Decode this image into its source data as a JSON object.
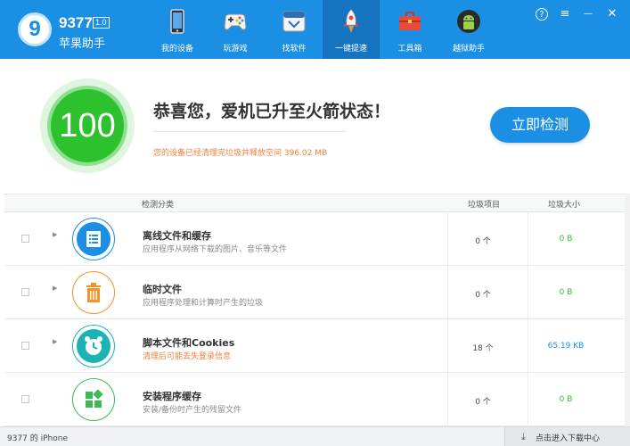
{
  "app": {
    "logo_char": "9",
    "title": "9377",
    "version": "1.0",
    "subtitle": "苹果助手"
  },
  "nav": [
    {
      "label": "我的设备",
      "icon": "phone-icon"
    },
    {
      "label": "玩游戏",
      "icon": "gamepad-icon"
    },
    {
      "label": "找软件",
      "icon": "app-store-icon"
    },
    {
      "label": "一键提速",
      "icon": "rocket-icon",
      "active": true
    },
    {
      "label": "工具箱",
      "icon": "toolbox-icon"
    },
    {
      "label": "越狱助手",
      "icon": "android-icon"
    }
  ],
  "window_controls": {
    "help": "?",
    "menu": "≡",
    "minimize": "—",
    "close": "✕"
  },
  "score": {
    "value": "100",
    "headline": "恭喜您，爱机已升至火箭状态！",
    "subline": "您的设备已经清理完垃圾并释放空间 396.02 MB",
    "check_button": "立即检测"
  },
  "table": {
    "headers": {
      "category": "检测分类",
      "items": "垃圾项目",
      "size": "垃圾大小"
    },
    "rows": [
      {
        "title": "离线文件和缓存",
        "desc": "应用程序从网络下载的图片、音乐等文件",
        "count": "0 个",
        "size": "0 B",
        "icon": "document-list-icon",
        "color": "#1a8fe3"
      },
      {
        "title": "临时文件",
        "desc": "应用程序处理和计算时产生的垃圾",
        "count": "0 个",
        "size": "0 B",
        "icon": "trash-can-icon",
        "color": "#f5922a"
      },
      {
        "title": "脚本文件和Cookies",
        "desc": "清理后可能丢失登录信息",
        "count": "18 个",
        "size": "65.19 KB",
        "icon": "alarm-clock-icon",
        "color": "#1bb3b3",
        "warn": true
      },
      {
        "title": "安装程序缓存",
        "desc": "安装/备份时产生的残留文件",
        "count": "0 个",
        "size": "0 B",
        "icon": "app-grid-icon",
        "color": "#3dbb50"
      }
    ]
  },
  "status": {
    "device": "9377 的 iPhone",
    "download_center": "点击进入下载中心"
  },
  "colors": {
    "brand_blue": "#1a8fe3",
    "score_green": "#2ec12e",
    "warning_orange": "#f07f3b"
  }
}
